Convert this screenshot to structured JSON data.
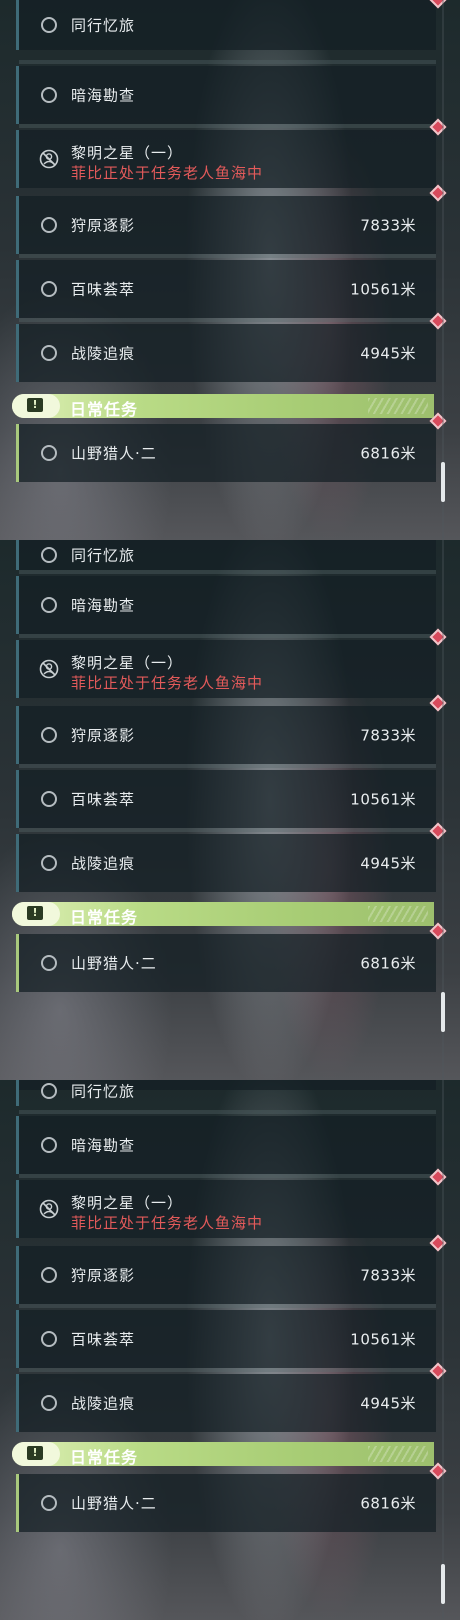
{
  "colors": {
    "blocked_text": "#e25a5a",
    "section_accent": "#a7cc74",
    "marker": "#d84a5c"
  },
  "quests": [
    {
      "title": "同行忆旅"
    },
    {
      "title": "暗海勘查"
    },
    {
      "title": "黎明之星（一）",
      "status": "菲比正处于任务老人鱼海中",
      "icon": "blocked-person-icon"
    },
    {
      "title": "狩原逐影",
      "distance": "7833米"
    },
    {
      "title": "百味荟萃",
      "distance": "10561米"
    },
    {
      "title": "战陵追痕",
      "distance": "4945米"
    }
  ],
  "section": {
    "label": "日常任务",
    "icon": "exclamation-icon"
  },
  "daily": [
    {
      "title": "山野猎人·二",
      "distance": "6816米"
    }
  ]
}
